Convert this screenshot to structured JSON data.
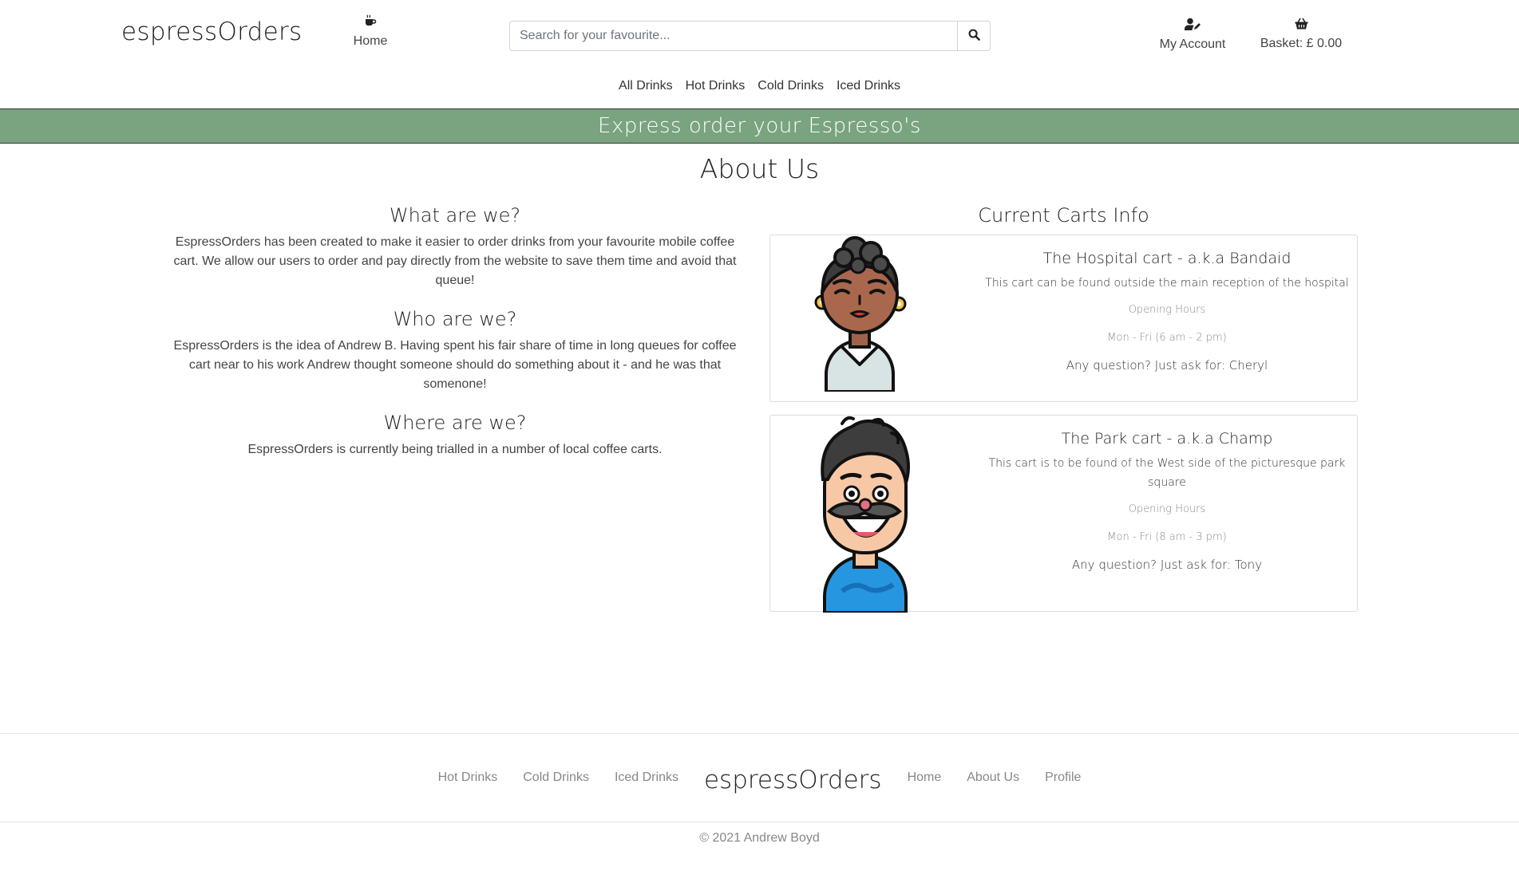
{
  "header": {
    "logo": "espressOrders",
    "home_label": "Home",
    "search_placeholder": "Search for your favourite...",
    "account_label": "My Account",
    "basket_label": "Basket: £ 0.00",
    "categories": [
      "All Drinks",
      "Hot Drinks",
      "Cold Drinks",
      "Iced Drinks"
    ],
    "icons": {
      "home": "coffee-mug-icon",
      "search": "search-icon",
      "account": "user-edit-icon",
      "basket": "shopping-basket-icon"
    }
  },
  "banner": {
    "text": "Express order your Espresso's",
    "color": "#7aa37f"
  },
  "main": {
    "title": "About Us",
    "sections": [
      {
        "heading": "What are we?",
        "body": "EspressOrders has been created to make it easier to order drinks from your favourite mobile coffee cart. We allow our users to order and pay directly from the website to save them time and avoid that queue!"
      },
      {
        "heading": "Who are we?",
        "body": "EspressOrders is the idea of Andrew B. Having spent his fair share of time in long queues for coffee cart near to his work Andrew thought someone should do something about it - and he was that somenone!"
      },
      {
        "heading": "Where are we?",
        "body": "EspressOrders is currently being trialled in a number of local coffee carts."
      }
    ],
    "carts_heading": "Current Carts Info",
    "carts": [
      {
        "name": "The Hospital cart - a.k.a Bandaid",
        "description": "This cart can be found outside the main reception of the hospital",
        "hours_heading": "Opening Hours",
        "hours": "Mon - Fri (6 am - 2 pm)",
        "contact": "Any question? Just ask for: Cheryl",
        "avatar": "woman-avatar"
      },
      {
        "name": "The Park cart - a.k.a Champ",
        "description": "This cart is to be found of the West side of the picturesque park square",
        "hours_heading": "Opening Hours",
        "hours": "Mon - Fri (8 am - 3 pm)",
        "contact": "Any question? Just ask for: Tony",
        "avatar": "mustache-man-avatar"
      }
    ]
  },
  "footer": {
    "links_left": [
      "Hot Drinks",
      "Cold Drinks",
      "Iced Drinks"
    ],
    "logo": "espressOrders",
    "links_right": [
      "Home",
      "About Us",
      "Profile"
    ],
    "copyright": "© 2021 Andrew Boyd"
  }
}
